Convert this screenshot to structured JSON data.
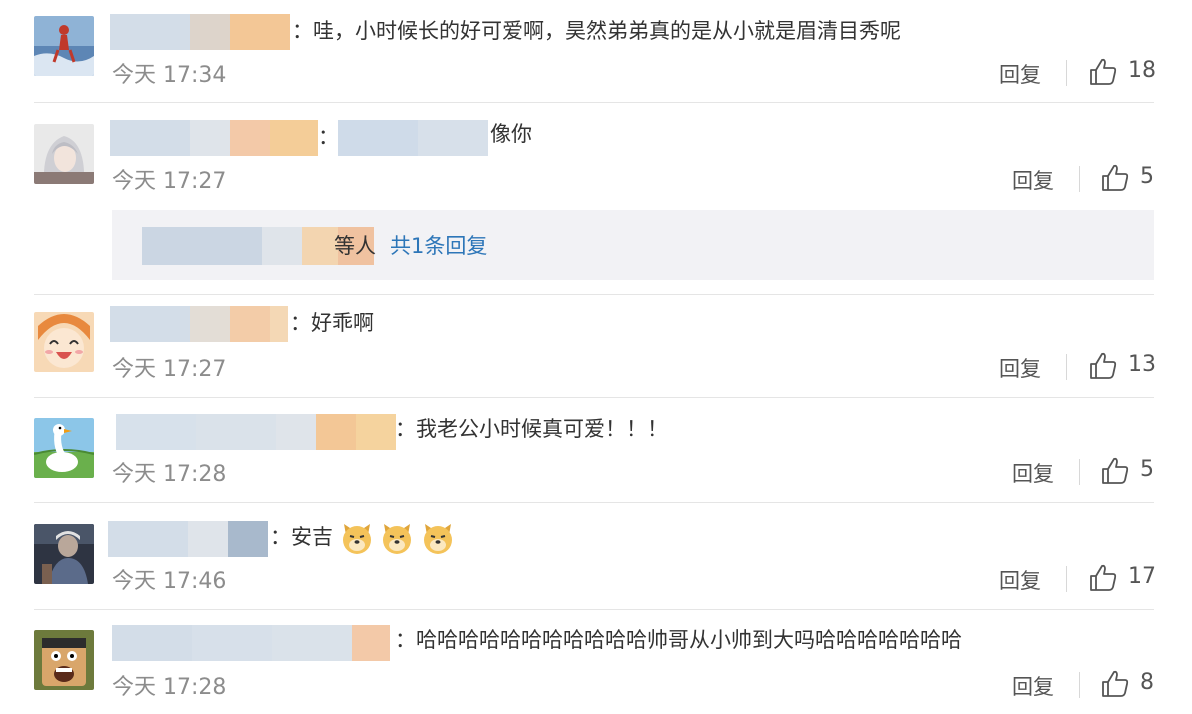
{
  "icons": {
    "like": "thumbs-up-icon",
    "emoji": "doge-emoji-icon"
  },
  "colors": {
    "link": "#2d76b8",
    "time": "#8c8c8c",
    "blur_blue": "#cfdbe9",
    "blur_orange": "#f4c89a"
  },
  "comments": [
    {
      "text": "：哇，小时候长的好可爱啊，昊然弟弟真的是从小就是眉清目秀呢",
      "time": "今天 17:34",
      "reply": "回复",
      "likes": "18"
    },
    {
      "text": "：",
      "text2": "像你",
      "time": "今天 17:27",
      "reply": "回复",
      "likes": "5"
    },
    {
      "text": "：好乖啊",
      "time": "今天 17:27",
      "reply": "回复",
      "likes": "13"
    },
    {
      "text": "：我老公小时候真可爱！！！",
      "time": "今天 17:28",
      "reply": "回复",
      "likes": "5"
    },
    {
      "text": "：安吉",
      "time": "今天 17:46",
      "reply": "回复",
      "likes": "17"
    },
    {
      "text": "：哈哈哈哈哈哈哈哈哈哈哈帅哥从小帅到大吗哈哈哈哈哈哈哈",
      "time": "今天 17:28",
      "reply": "回复",
      "likes": "8"
    }
  ],
  "subreply": {
    "label": "等人",
    "link": "共1条回复"
  }
}
